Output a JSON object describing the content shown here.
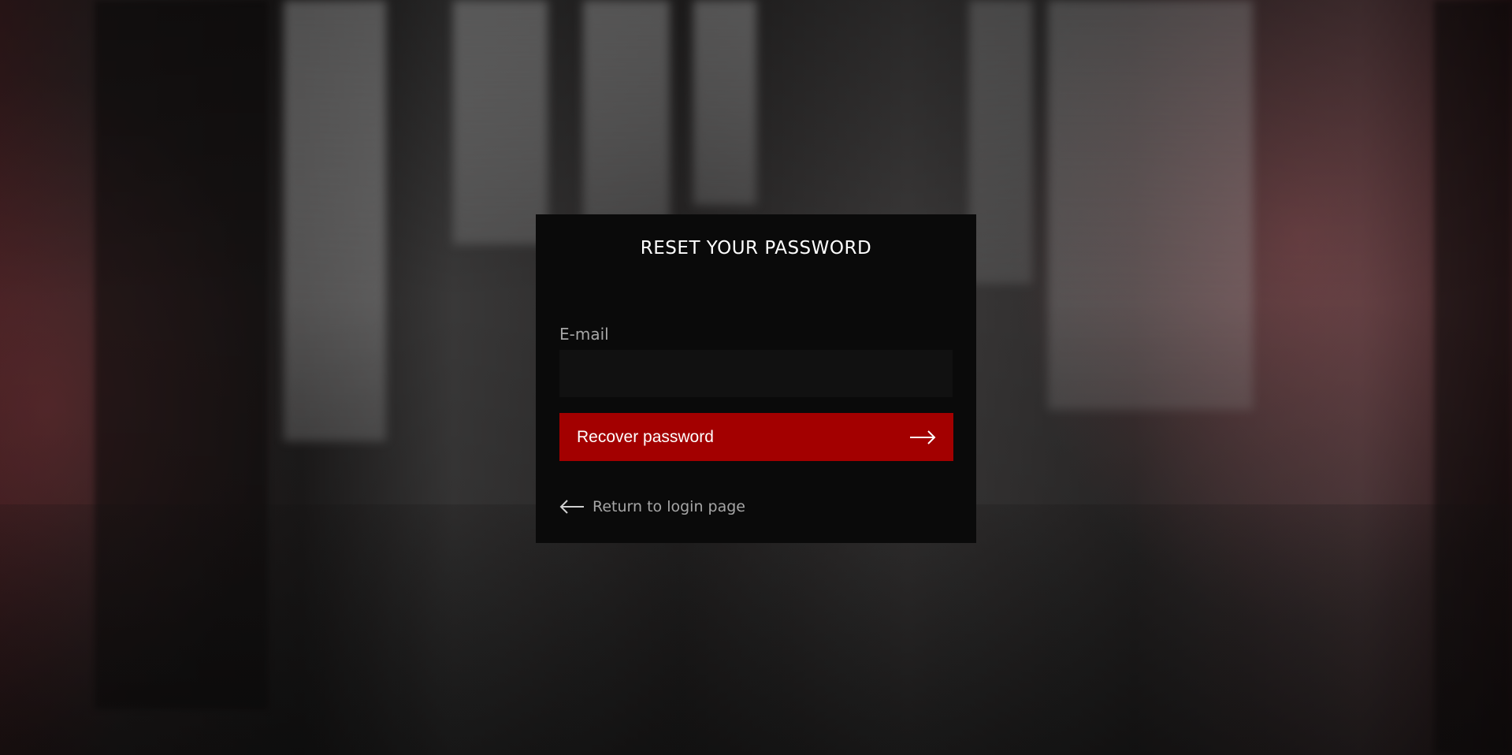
{
  "page": {
    "title": "RESET YOUR PASSWORD"
  },
  "form": {
    "email_label": "E-mail",
    "email_value": "",
    "email_placeholder": "",
    "submit_label": "Recover password",
    "submit_icon": "arrow-right-icon",
    "return_label": "Return to login page",
    "return_icon": "arrow-left-icon"
  },
  "colors": {
    "card_background": "#0a0a0a",
    "input_background": "#111111",
    "accent": "#a30000",
    "title_text": "#ffffff",
    "muted_text": "#a6a6a6"
  }
}
